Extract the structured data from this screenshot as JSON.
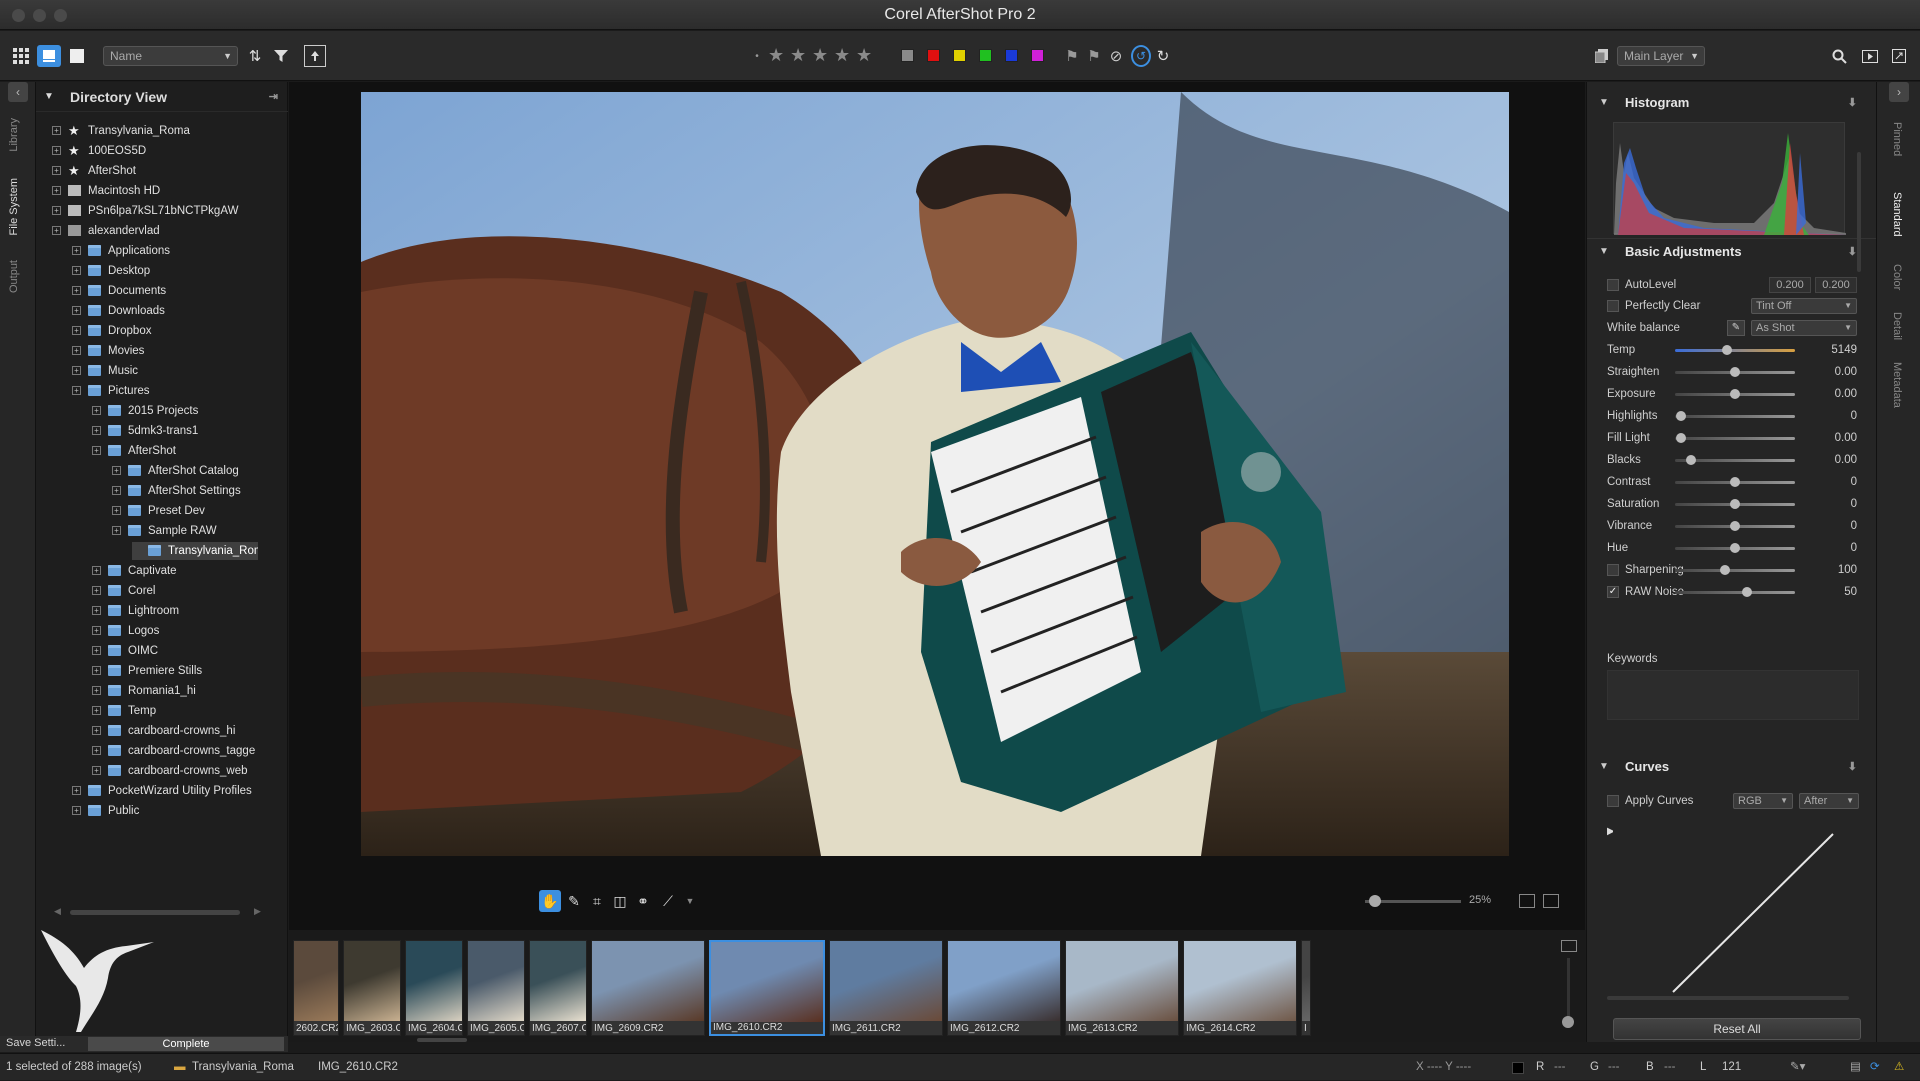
{
  "window": {
    "title": "Corel AfterShot Pro 2"
  },
  "toolbar": {
    "sort_field": "Name",
    "layer_select": "Main Layer"
  },
  "colors": {
    "swatches": [
      "#8a8a8a",
      "#e01010",
      "#e0d000",
      "#20c020",
      "#1a3ad8",
      "#d020d8"
    ],
    "accent": "#3c8fe0"
  },
  "left_tabs": [
    "Library",
    "File System",
    "Output"
  ],
  "directory": {
    "title": "Directory View",
    "items": [
      {
        "label": "Transylvania_Roma",
        "level": 0,
        "icon": "star"
      },
      {
        "label": "100EOS5D",
        "level": 0,
        "icon": "star"
      },
      {
        "label": "AfterShot",
        "level": 0,
        "icon": "star"
      },
      {
        "label": "Macintosh HD",
        "level": 0,
        "icon": "drive"
      },
      {
        "label": "PSn6lpa7kSL71bNCTPkgAW",
        "level": 0,
        "icon": "drive"
      },
      {
        "label": "alexandervlad",
        "level": 0,
        "icon": "home"
      },
      {
        "label": "Applications",
        "level": 1,
        "icon": "folder"
      },
      {
        "label": "Desktop",
        "level": 1,
        "icon": "folder"
      },
      {
        "label": "Documents",
        "level": 1,
        "icon": "folder"
      },
      {
        "label": "Downloads",
        "level": 1,
        "icon": "folder"
      },
      {
        "label": "Dropbox",
        "level": 1,
        "icon": "folder"
      },
      {
        "label": "Movies",
        "level": 1,
        "icon": "folder"
      },
      {
        "label": "Music",
        "level": 1,
        "icon": "folder"
      },
      {
        "label": "Pictures",
        "level": 1,
        "icon": "folder"
      },
      {
        "label": "2015 Projects",
        "level": 2,
        "icon": "folder"
      },
      {
        "label": "5dmk3-trans1",
        "level": 2,
        "icon": "folder"
      },
      {
        "label": "AfterShot",
        "level": 2,
        "icon": "folder"
      },
      {
        "label": "AfterShot Catalog",
        "level": 3,
        "icon": "folder"
      },
      {
        "label": "AfterShot Settings",
        "level": 3,
        "icon": "folder"
      },
      {
        "label": "Preset Dev",
        "level": 3,
        "icon": "folder"
      },
      {
        "label": "Sample RAW",
        "level": 3,
        "icon": "folder"
      },
      {
        "label": "Transylvania_Rom",
        "level": 4,
        "icon": "folder",
        "selected": true
      },
      {
        "label": "Captivate",
        "level": 2,
        "icon": "folder"
      },
      {
        "label": "Corel",
        "level": 2,
        "icon": "folder"
      },
      {
        "label": "Lightroom",
        "level": 2,
        "icon": "folder"
      },
      {
        "label": "Logos",
        "level": 2,
        "icon": "folder"
      },
      {
        "label": "OIMC",
        "level": 2,
        "icon": "folder"
      },
      {
        "label": "Premiere Stills",
        "level": 2,
        "icon": "folder"
      },
      {
        "label": "Romania1_hi",
        "level": 2,
        "icon": "folder"
      },
      {
        "label": "Temp",
        "level": 2,
        "icon": "folder"
      },
      {
        "label": "cardboard-crowns_hi",
        "level": 2,
        "icon": "folder"
      },
      {
        "label": "cardboard-crowns_tagge",
        "level": 2,
        "icon": "folder"
      },
      {
        "label": "cardboard-crowns_web",
        "level": 2,
        "icon": "folder"
      },
      {
        "label": "PocketWizard Utility Profiles",
        "level": 1,
        "icon": "folder"
      },
      {
        "label": "Public",
        "level": 1,
        "icon": "folder"
      }
    ]
  },
  "save_row": {
    "save_label": "Save Setti...",
    "progress_label": "Complete"
  },
  "viewer": {
    "zoom": "25%",
    "zoom_fraction": 0.1
  },
  "filmstrip": [
    {
      "name": "2602.CR2"
    },
    {
      "name": "IMG_2603.CR2"
    },
    {
      "name": "IMG_2604.CR2"
    },
    {
      "name": "IMG_2605.CR2"
    },
    {
      "name": "IMG_2607.CR2"
    },
    {
      "name": "IMG_2609.CR2"
    },
    {
      "name": "IMG_2610.CR2",
      "selected": true
    },
    {
      "name": "IMG_2611.CR2"
    },
    {
      "name": "IMG_2612.CR2"
    },
    {
      "name": "IMG_2613.CR2"
    },
    {
      "name": "IMG_2614.CR2"
    },
    {
      "name": "I"
    }
  ],
  "right_tabs": [
    "Pinned",
    "Standard",
    "Color",
    "Detail",
    "Metadata"
  ],
  "histogram": {
    "title": "Histogram"
  },
  "basic": {
    "title": "Basic Adjustments",
    "autolevel": {
      "label": "AutoLevel",
      "v1": "0.200",
      "v2": "0.200"
    },
    "perfectly_clear": {
      "label": "Perfectly Clear",
      "option": "Tint Off"
    },
    "white_balance": {
      "label": "White balance",
      "option": "As Shot"
    },
    "sliders": [
      {
        "label": "Temp",
        "value": "5149",
        "pos": 0.43,
        "checkbox": false,
        "temp": true
      },
      {
        "label": "Straighten",
        "value": "0.00",
        "pos": 0.5,
        "checkbox": false
      },
      {
        "label": "Exposure",
        "value": "0.00",
        "pos": 0.5,
        "checkbox": false
      },
      {
        "label": "Highlights",
        "value": "0",
        "pos": 0.05,
        "checkbox": false
      },
      {
        "label": "Fill Light",
        "value": "0.00",
        "pos": 0.05,
        "checkbox": false
      },
      {
        "label": "Blacks",
        "value": "0.00",
        "pos": 0.13,
        "checkbox": false
      },
      {
        "label": "Contrast",
        "value": "0",
        "pos": 0.5,
        "checkbox": false
      },
      {
        "label": "Saturation",
        "value": "0",
        "pos": 0.5,
        "checkbox": false
      },
      {
        "label": "Vibrance",
        "value": "0",
        "pos": 0.5,
        "checkbox": false
      },
      {
        "label": "Hue",
        "value": "0",
        "pos": 0.5,
        "checkbox": false
      },
      {
        "label": "Sharpening",
        "value": "100",
        "pos": 0.42,
        "checkbox": true,
        "checked": false
      },
      {
        "label": "RAW Noise",
        "value": "50",
        "pos": 0.6,
        "checkbox": true,
        "checked": true
      }
    ],
    "keywords_label": "Keywords"
  },
  "curves": {
    "title": "Curves",
    "apply_label": "Apply Curves",
    "channel": "RGB",
    "mode": "After"
  },
  "reset_label": "Reset All",
  "status": {
    "selection": "1 selected of 288 image(s)",
    "folder": "Transylvania_Roma",
    "file": "IMG_2610.CR2",
    "coords": "X ---- Y ----",
    "r": "R",
    "r_val": "---",
    "g": "G",
    "g_val": "---",
    "b": "B",
    "b_val": "---",
    "l": "L",
    "l_val": "121"
  }
}
